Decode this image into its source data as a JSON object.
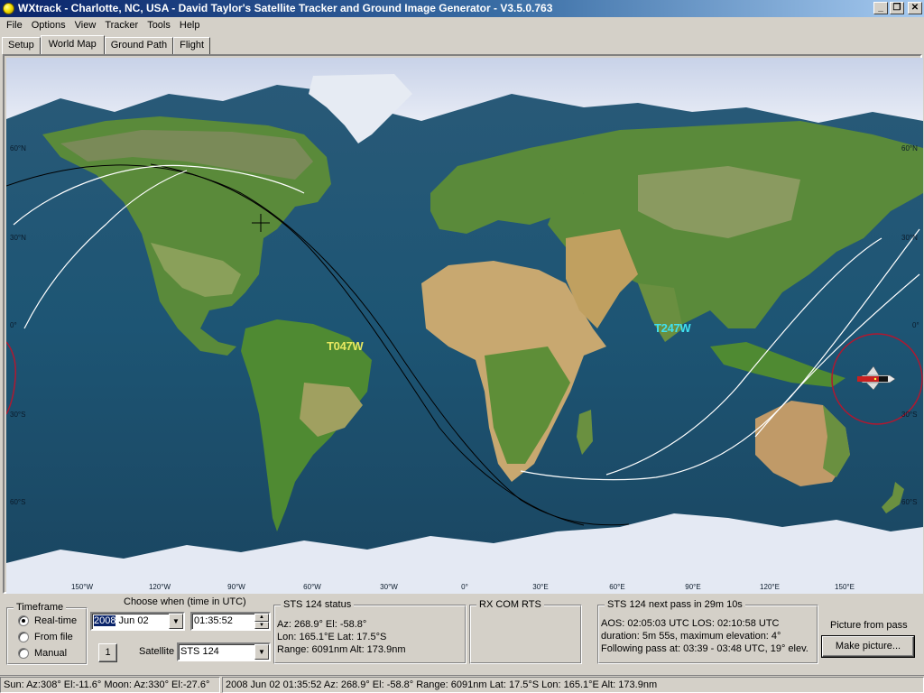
{
  "window": {
    "title": "WXtrack - Charlotte, NC, USA - David Taylor's Satellite Tracker and Ground Image Generator - V3.5.0.763",
    "buttons": {
      "minimize": "_",
      "restore": "❐",
      "close": "✕"
    }
  },
  "menu": [
    "File",
    "Options",
    "View",
    "Tracker",
    "Tools",
    "Help"
  ],
  "tabs": [
    {
      "label": "Setup",
      "active": false
    },
    {
      "label": "World Map",
      "active": true
    },
    {
      "label": "Ground Path",
      "active": false
    },
    {
      "label": "Flight",
      "active": false
    }
  ],
  "map": {
    "lon_labels": [
      "150°W",
      "120°W",
      "90°W",
      "60°W",
      "30°W",
      "0°",
      "30°E",
      "60°E",
      "90°E",
      "120°E",
      "150°E"
    ],
    "lat_labels_left": [
      "60°N",
      "30°N",
      "0°",
      "30°S",
      "60°S"
    ],
    "lat_labels_right": [
      "60°N",
      "30°N",
      "0°",
      "30°S",
      "60°S"
    ],
    "pass_labels": [
      {
        "text": "T047W",
        "color": "#e8e860"
      },
      {
        "text": "T247W",
        "color": "#40e0f0"
      }
    ],
    "satellite_icon": "space-shuttle-icon",
    "home_marker": "crosshair-icon",
    "colors": {
      "ground_track_past": "#000000",
      "ground_track_future": "#ffffff",
      "footprint": "#b01830"
    }
  },
  "timeframe": {
    "title": "Timeframe",
    "options": [
      {
        "label": "Real-time",
        "checked": true
      },
      {
        "label": "From file",
        "checked": false
      },
      {
        "label": "Manual",
        "checked": false
      }
    ]
  },
  "choose_when": {
    "label": "Choose when (time in UTC)",
    "date_year": "2008",
    "date_rest": " Jun 02",
    "time": "01:35:52",
    "step_button": "1",
    "satellite_label": "Satellite",
    "satellite": "STS 124"
  },
  "status": {
    "title": "STS 124 status",
    "lines": [
      "Az: 268.9°  El: -58.8°",
      "Lon: 165.1°E  Lat: 17.5°S",
      "Range: 6091nm  Alt: 173.9nm"
    ]
  },
  "rx": {
    "title": "RX COM RTS"
  },
  "next_pass": {
    "title": "STS 124 next pass in 29m 10s",
    "lines": [
      "AOS: 02:05:03 UTC  LOS: 02:10:58 UTC",
      "duration: 5m 55s,  maximum elevation: 4°",
      "Following pass at: 03:39 - 03:48 UTC, 19° elev."
    ]
  },
  "picture": {
    "label": "Picture from pass",
    "button": "Make picture..."
  },
  "statusbar": {
    "left": "Sun: Az:308° El:-11.6°  Moon: Az:330° El:-27.6°",
    "right": "2008 Jun 02  01:35:52  Az: 268.9°  El: -58.8°  Range: 6091nm  Lat: 17.5°S  Lon: 165.1°E  Alt: 173.9nm"
  }
}
